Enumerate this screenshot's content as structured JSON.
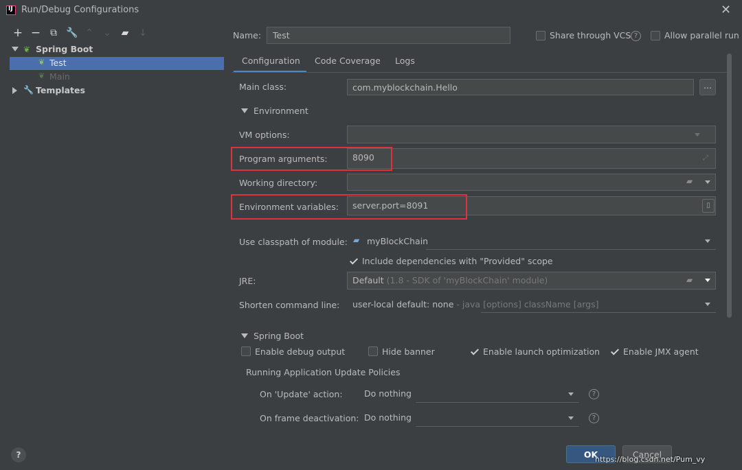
{
  "window": {
    "title": "Run/Debug Configurations"
  },
  "toolbar": {
    "icons": [
      "add-icon",
      "remove-icon",
      "copy-icon",
      "wrench-icon",
      "move-up-icon",
      "move-down-icon",
      "new-folder-icon",
      "sort-icon"
    ]
  },
  "tree": {
    "spring_boot": "Spring Boot",
    "items": [
      "Test",
      "Main"
    ],
    "templates": "Templates"
  },
  "header": {
    "name_label": "Name:",
    "name_value": "Test",
    "share_label": "Share through VCS",
    "parallel_label": "Allow parallel run"
  },
  "tabs": [
    "Configuration",
    "Code Coverage",
    "Logs"
  ],
  "form": {
    "main_class_label": "Main class:",
    "main_class_value": "com.myblockchain.Hello",
    "browse_label": "...",
    "environment_label": "Environment",
    "vm_options_label": "VM options:",
    "program_args_label": "Program arguments:",
    "program_args_value": "8090",
    "working_dir_label": "Working directory:",
    "env_vars_label": "Environment variables:",
    "env_vars_value": "server.port=8091",
    "classpath_label": "Use classpath of module:",
    "classpath_value": "myBlockChain",
    "include_deps_label": "Include dependencies with \"Provided\" scope",
    "jre_label": "JRE:",
    "jre_value": "Default",
    "jre_hint": "(1.8 - SDK of 'myBlockChain' module)",
    "shorten_label": "Shorten command line:",
    "shorten_value": "user-local default: none",
    "shorten_hint": "- java [options] className [args]"
  },
  "spring_boot_section": {
    "title": "Spring Boot",
    "debug_output": "Enable debug output",
    "hide_banner": "Hide banner",
    "launch_opt": "Enable launch optimization",
    "jmx_agent": "Enable JMX agent",
    "policies_title": "Running Application Update Policies",
    "on_update_label": "On 'Update' action:",
    "on_update_value": "Do nothing",
    "on_frame_label": "On frame deactivation:",
    "on_frame_value": "Do nothing"
  },
  "footer": {
    "help": "?",
    "ok": "OK",
    "cancel": "Cancel",
    "watermark": "https://blog.csdn.net/Pum_vy"
  },
  "colors": {
    "bg": "#3c3f41",
    "selected": "#4b6eaf",
    "highlight": "#e0323c",
    "ok_button": "#365880"
  }
}
